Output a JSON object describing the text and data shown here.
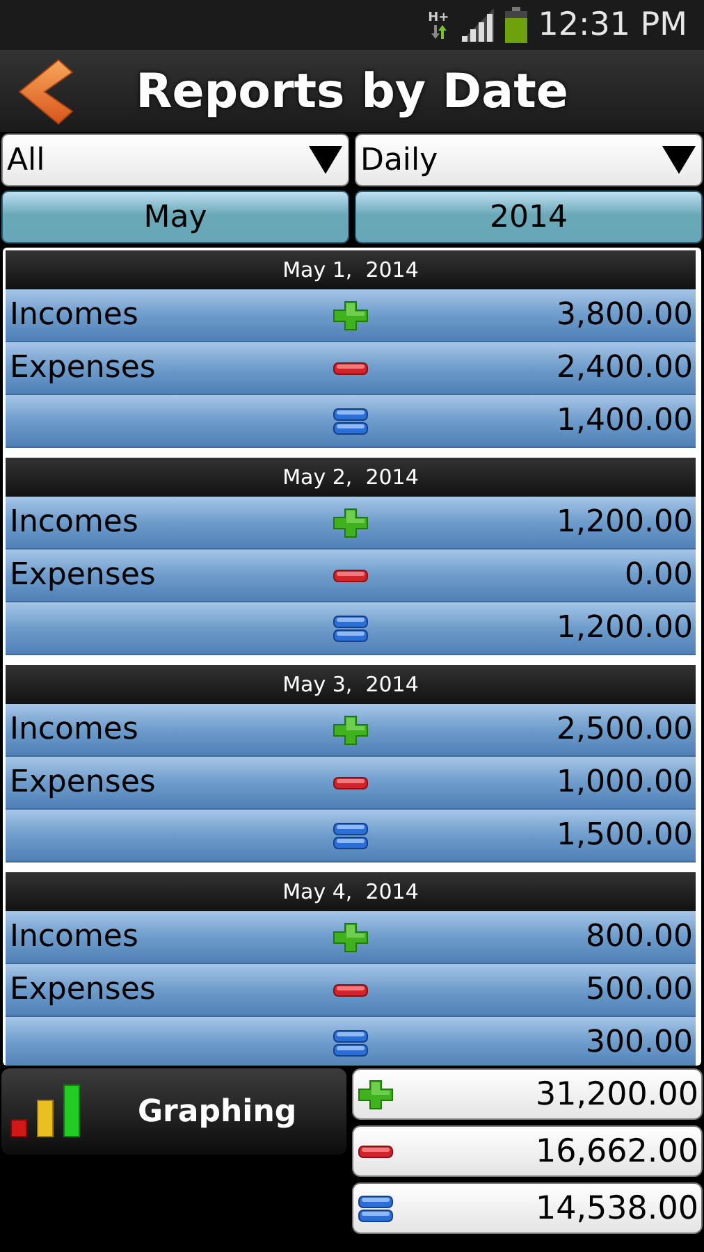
{
  "status_bar": {
    "network": "H+",
    "time": "12:31 PM"
  },
  "title_bar": {
    "title": "Reports by Date"
  },
  "filters": [
    {
      "value": "All"
    },
    {
      "value": "Daily"
    }
  ],
  "period": [
    {
      "label": "May"
    },
    {
      "label": "2014"
    }
  ],
  "days": [
    {
      "date": "May 1,  2014",
      "rows": [
        {
          "kind": "income",
          "label": "Incomes",
          "amount": "3,800.00"
        },
        {
          "kind": "expense",
          "label": "Expenses",
          "amount": "2,400.00"
        },
        {
          "kind": "balance",
          "amount": "1,400.00"
        }
      ]
    },
    {
      "date": "May 2,  2014",
      "rows": [
        {
          "kind": "income",
          "label": "Incomes",
          "amount": "1,200.00"
        },
        {
          "kind": "expense",
          "label": "Expenses",
          "amount": "0.00"
        },
        {
          "kind": "balance",
          "amount": "1,200.00"
        }
      ]
    },
    {
      "date": "May 3,  2014",
      "rows": [
        {
          "kind": "income",
          "label": "Incomes",
          "amount": "2,500.00"
        },
        {
          "kind": "expense",
          "label": "Expenses",
          "amount": "1,000.00"
        },
        {
          "kind": "balance",
          "amount": "1,500.00"
        }
      ]
    },
    {
      "date": "May 4,  2014",
      "rows": [
        {
          "kind": "income",
          "label": "Incomes",
          "amount": "800.00"
        },
        {
          "kind": "expense",
          "label": "Expenses",
          "amount": "500.00"
        },
        {
          "kind": "balance",
          "amount": "300.00"
        }
      ]
    }
  ],
  "graphing_button": {
    "label": "Graphing"
  },
  "totals": [
    {
      "kind": "income",
      "amount": "31,200.00"
    },
    {
      "kind": "expense",
      "amount": "16,662.00"
    },
    {
      "kind": "balance",
      "amount": "14,538.00"
    }
  ]
}
